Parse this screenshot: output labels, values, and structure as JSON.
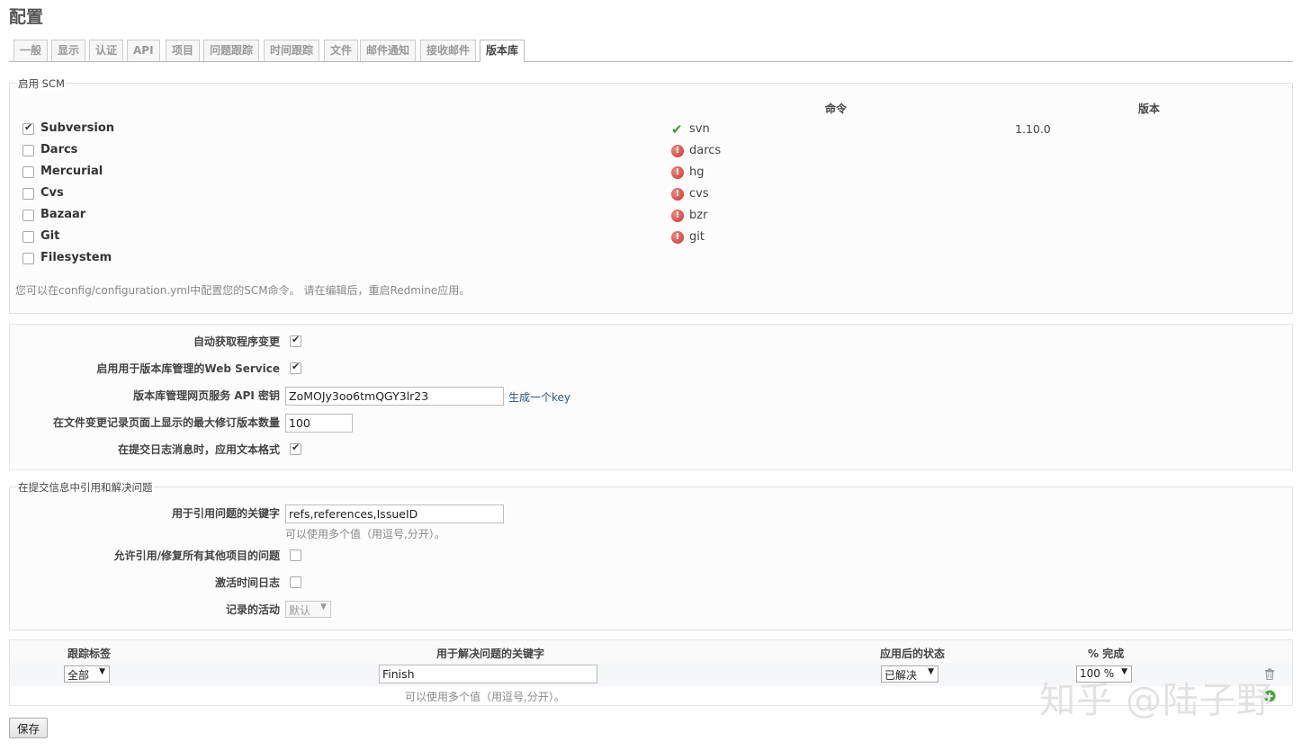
{
  "page": {
    "title": "配置"
  },
  "tabs": [
    {
      "label": "一般"
    },
    {
      "label": "显示"
    },
    {
      "label": "认证"
    },
    {
      "label": "API"
    },
    {
      "label": "项目"
    },
    {
      "label": "问题跟踪"
    },
    {
      "label": "时间跟踪"
    },
    {
      "label": "文件"
    },
    {
      "label": "邮件通知"
    },
    {
      "label": "接收邮件"
    },
    {
      "label": "版本库"
    }
  ],
  "scm": {
    "legend": "启用 SCM",
    "col_command": "命令",
    "col_version": "版本",
    "items": [
      {
        "name": "Subversion",
        "checked": true,
        "command": "svn",
        "status": "ok",
        "version": "1.10.0"
      },
      {
        "name": "Darcs",
        "checked": false,
        "command": "darcs",
        "status": "error",
        "version": ""
      },
      {
        "name": "Mercurial",
        "checked": false,
        "command": "hg",
        "status": "error",
        "version": ""
      },
      {
        "name": "Cvs",
        "checked": false,
        "command": "cvs",
        "status": "error",
        "version": ""
      },
      {
        "name": "Bazaar",
        "checked": false,
        "command": "bzr",
        "status": "error",
        "version": ""
      },
      {
        "name": "Git",
        "checked": false,
        "command": "git",
        "status": "error",
        "version": ""
      },
      {
        "name": "Filesystem",
        "checked": false,
        "command": "",
        "status": "none",
        "version": ""
      }
    ],
    "note": "您可以在config/configuration.yml中配置您的SCM命令。 请在编辑后，重启Redmine应用。"
  },
  "settings": {
    "autofetch_label": "自动获取程序变更",
    "ws_label": "启用用于版本库管理的Web Service",
    "api_key_label": "版本库管理网页服务 API 密钥",
    "api_key_value": "ZoMOJy3oo6tmQGY3lr23",
    "generate_key_label": "生成一个key",
    "max_revisions_label": "在文件变更记录页面上显示的最大修订版本数量",
    "max_revisions_value": "100",
    "text_formatting_label": "在提交日志消息时，应用文本格式"
  },
  "commit_refs": {
    "legend": "在提交信息中引用和解决问题",
    "keywords_label": "用于引用问题的关键字",
    "keywords_value": "refs,references,IssueID",
    "keywords_hint": "可以使用多个值（用逗号,分开）。",
    "cross_project_label": "允许引用/修复所有其他项目的问题",
    "time_log_label": "激活时间日志",
    "activity_label": "记录的活动",
    "activity_value": "默认"
  },
  "fix_table": {
    "col_tracker": "跟踪标签",
    "col_keywords": "用于解决问题的关键字",
    "col_status": "应用后的状态",
    "col_done": "% 完成",
    "row": {
      "tracker": "全部",
      "keywords": "Finish",
      "status": "已解决",
      "done": "100 %"
    },
    "hint": "可以使用多个值（用逗号,分开）。"
  },
  "watermark": "知乎 @陆子野",
  "save_label": "保存"
}
